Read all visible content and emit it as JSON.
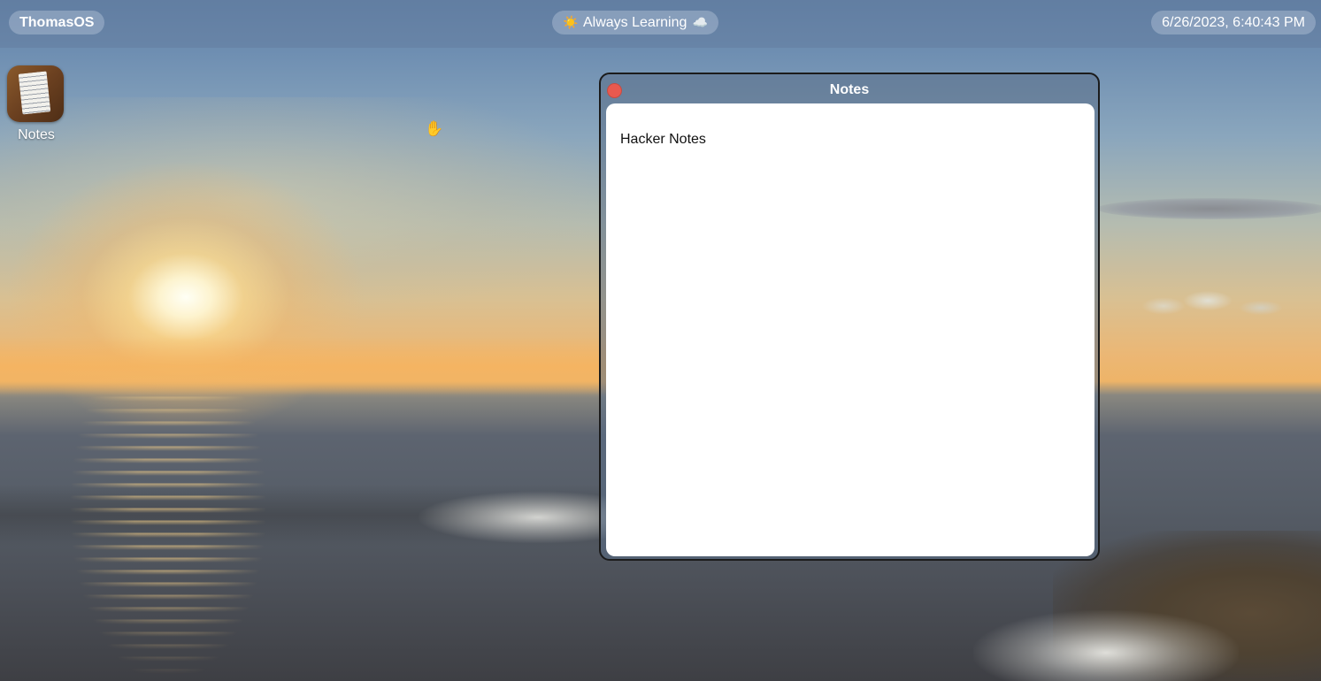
{
  "menubar": {
    "os_name": "ThomasOS",
    "status": {
      "left_emoji": "☀️",
      "text": "Always Learning",
      "right_emoji": "☁️"
    },
    "clock": "6/26/2023, 6:40:43 PM"
  },
  "desktop": {
    "icons": [
      {
        "label": "Notes",
        "icon": "notes-icon"
      }
    ]
  },
  "notes_window": {
    "title": "Notes",
    "content": "Hacker Notes",
    "close_color": "#e8594f"
  }
}
